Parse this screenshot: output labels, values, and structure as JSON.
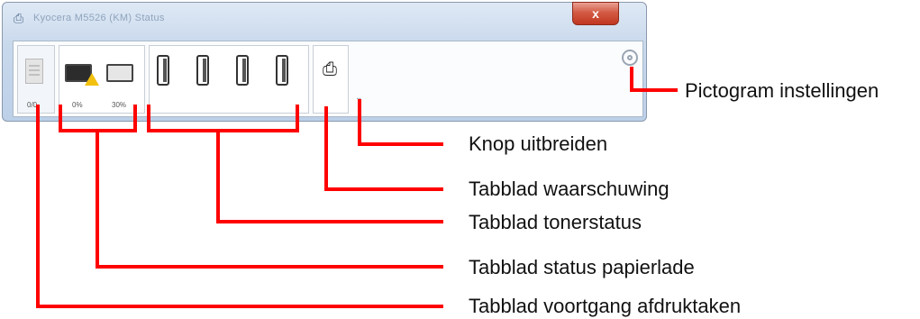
{
  "window": {
    "title_icon": "printer-icon",
    "title_text": "Kyocera M5526 (KM) Status",
    "close_label": "x"
  },
  "tabs": {
    "print_progress_value": "0/0",
    "paper_tray_1": "0%",
    "paper_tray_2": "30%"
  },
  "icons": {
    "expand": "chevron-down-icon",
    "settings": "gear-icon"
  },
  "callouts": {
    "settings_icon": "Pictogram instellingen",
    "expand_button": "Knop uitbreiden",
    "alert_tab": "Tabblad waarschuwing",
    "toner_tab": "Tabblad tonerstatus",
    "paper_tab": "Tabblad status papierlade",
    "progress_tab": "Tabblad voortgang afdruktaken"
  },
  "colors": {
    "callout_line": "#ff0000",
    "close_button": "#c1361f",
    "warning": "#f2c10f"
  }
}
